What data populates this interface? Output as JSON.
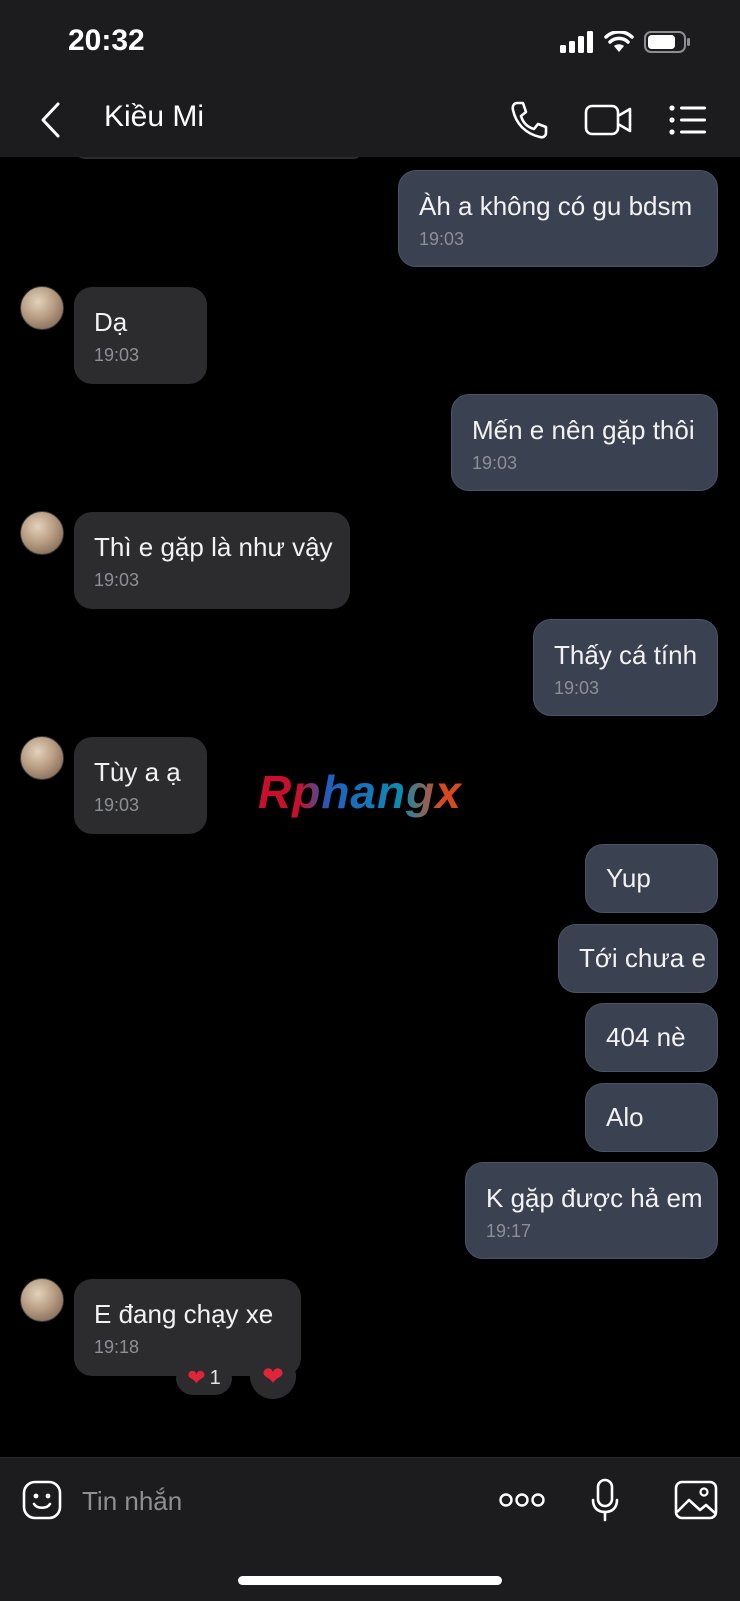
{
  "status": {
    "time": "20:32"
  },
  "header": {
    "title": "Kiều Mi"
  },
  "messages": [
    {
      "dir": "out",
      "text": "Àh a không có gu bdsm",
      "time": "19:03"
    },
    {
      "dir": "in",
      "text": "Dạ",
      "time": "19:03"
    },
    {
      "dir": "out",
      "text": "Mến e nên gặp thôi",
      "time": "19:03"
    },
    {
      "dir": "in",
      "text": "Thì e gặp là như vậy",
      "time": "19:03"
    },
    {
      "dir": "out",
      "text": "Thấy cá tính",
      "time": "19:03"
    },
    {
      "dir": "in",
      "text": "Tùy a ạ",
      "time": "19:03"
    },
    {
      "dir": "out",
      "text": "Yup"
    },
    {
      "dir": "out",
      "text": "Tới chưa e"
    },
    {
      "dir": "out",
      "text": "404 nè"
    },
    {
      "dir": "out",
      "text": "Alo"
    },
    {
      "dir": "out",
      "text": "K gặp được hả em",
      "time": "19:17"
    },
    {
      "dir": "in",
      "text": "E đang chạy xe",
      "time": "19:18"
    }
  ],
  "reactions": {
    "heart_count": "1",
    "heart_symbol": "❤",
    "colors": {
      "heart": "#e0243a"
    }
  },
  "watermark": "Rphangx",
  "composer": {
    "placeholder": "Tin nhắn"
  },
  "icons": {
    "back": "chevron-left-icon",
    "call": "phone-icon",
    "video": "video-camera-icon",
    "menu": "list-icon",
    "emoji": "sticker-icon",
    "more": "more-dots-icon",
    "mic": "microphone-icon",
    "photo": "image-icon"
  },
  "colors": {
    "incoming_bubble": "#2c2c2e",
    "outgoing_bubble": "#3a4150",
    "background": "#000000",
    "bar": "#1c1c1e"
  }
}
